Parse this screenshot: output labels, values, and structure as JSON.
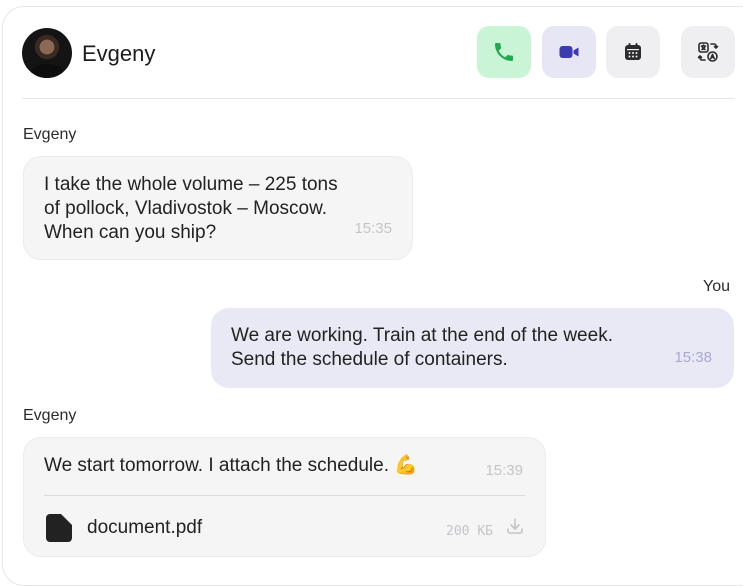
{
  "header": {
    "contact_name": "Evgeny",
    "buttons": {
      "call": "phone-icon",
      "video": "video-camera-icon",
      "calendar": "calendar-icon",
      "translate": "translate-icon"
    }
  },
  "messages": [
    {
      "sender": "Evgeny",
      "direction": "incoming",
      "text": "I take the whole volume – 225 tons\nof pollock, Vladivostok – Moscow.\nWhen can you ship?",
      "time": "15:35"
    },
    {
      "sender": "You",
      "direction": "outgoing",
      "text": "We are working. Train at the end of the week.\nSend the schedule of containers.",
      "time": "15:38"
    },
    {
      "sender": "Evgeny",
      "direction": "incoming",
      "text": "We start tomorrow. I attach the schedule.",
      "emoji": "💪",
      "time": "15:39",
      "attachment": {
        "name": "document.pdf",
        "size": "200 КБ"
      }
    }
  ],
  "colors": {
    "call_bg": "#c9f4d5",
    "call_icon": "#1faa50",
    "video_bg": "#e7e6f5",
    "video_icon": "#3b3ab0",
    "outgoing_bubble": "#e9e9f5",
    "incoming_bubble": "#f5f5f6"
  }
}
